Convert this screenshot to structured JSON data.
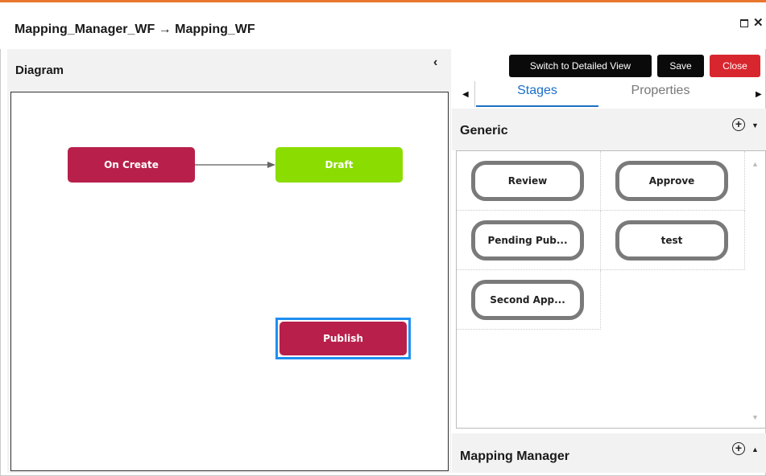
{
  "window": {
    "title": "Mapping_Manager_WF → Mapping_WF",
    "close_glyph": "✕"
  },
  "diagram": {
    "header": "Diagram",
    "collapse_glyph": "‹",
    "nodes": {
      "on_create": "On Create",
      "draft": "Draft",
      "publish": "Publish"
    },
    "colors": {
      "start_node": "#b8204b",
      "draft_node": "#8bdc00",
      "selection": "#1f8ff0"
    }
  },
  "toolbar": {
    "switch_label": "Switch to Detailed View",
    "save_label": "Save",
    "close_label": "Close"
  },
  "tabs": {
    "left_arrow": "◀",
    "right_arrow": "▶",
    "stages": "Stages",
    "properties": "Properties"
  },
  "generic": {
    "title": "Generic",
    "plus_glyph": "+",
    "caret_glyph": "▼",
    "stages": [
      "Review",
      "Approve",
      "Pending Pub...",
      "test",
      "Second App..."
    ]
  },
  "mapping_manager": {
    "title": "Mapping Manager",
    "plus_glyph": "+",
    "caret_glyph": "▲"
  },
  "scroll": {
    "up_glyph": "▲",
    "down_glyph": "▼"
  }
}
